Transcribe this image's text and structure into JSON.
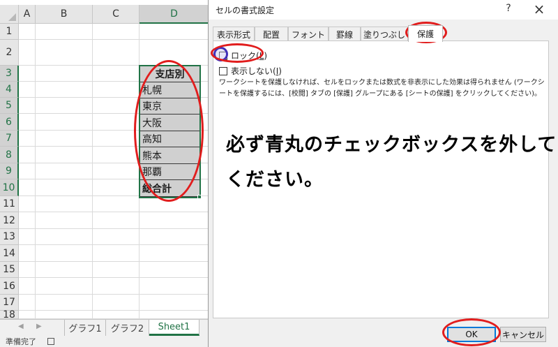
{
  "sheet": {
    "columns": [
      "A",
      "B",
      "C",
      "D"
    ],
    "selected_column": "D",
    "rows": [
      "1",
      "2",
      "3",
      "4",
      "5",
      "6",
      "7",
      "8",
      "9",
      "10",
      "11",
      "12",
      "13",
      "14",
      "15",
      "16",
      "17",
      "18"
    ],
    "header_cell": "支店別",
    "branches": [
      "札幌",
      "東京",
      "大阪",
      "高知",
      "熊本",
      "那覇"
    ],
    "total_cell": "総合計",
    "tabs": [
      "グラフ1",
      "グラフ2",
      "Sheet1"
    ],
    "active_tab": "Sheet1",
    "status": "準備完了"
  },
  "dialog": {
    "title": "セルの書式設定",
    "help": "?",
    "close": "×",
    "tabs": [
      "表示形式",
      "配置",
      "フォント",
      "罫線",
      "塗りつぶし",
      "保護"
    ],
    "active_tab": "保護",
    "lock_label": "ロック(",
    "lock_key": "L",
    "lock_suffix": ")",
    "lock_checked": false,
    "hidden_label": "表示しない(",
    "hidden_key": "I",
    "hidden_suffix": ")",
    "hidden_checked": false,
    "note": "ワークシートを保護しなければ、セルをロックまたは数式を非表示にした効果は得られません (ワークシートを保護するには、[校閲] タブの [保護] グループにある [シートの保護] をクリックしてください)。",
    "instruction_line1": "必ず青丸のチェックボックスを外して",
    "instruction_line2": "ください。",
    "ok_label": "OK",
    "cancel_label": "キャンセル"
  },
  "colors": {
    "excel_green": "#217346",
    "annotation_red": "#e11d1d",
    "annotation_blue": "#4130b8",
    "button_focus": "#0078d7"
  }
}
